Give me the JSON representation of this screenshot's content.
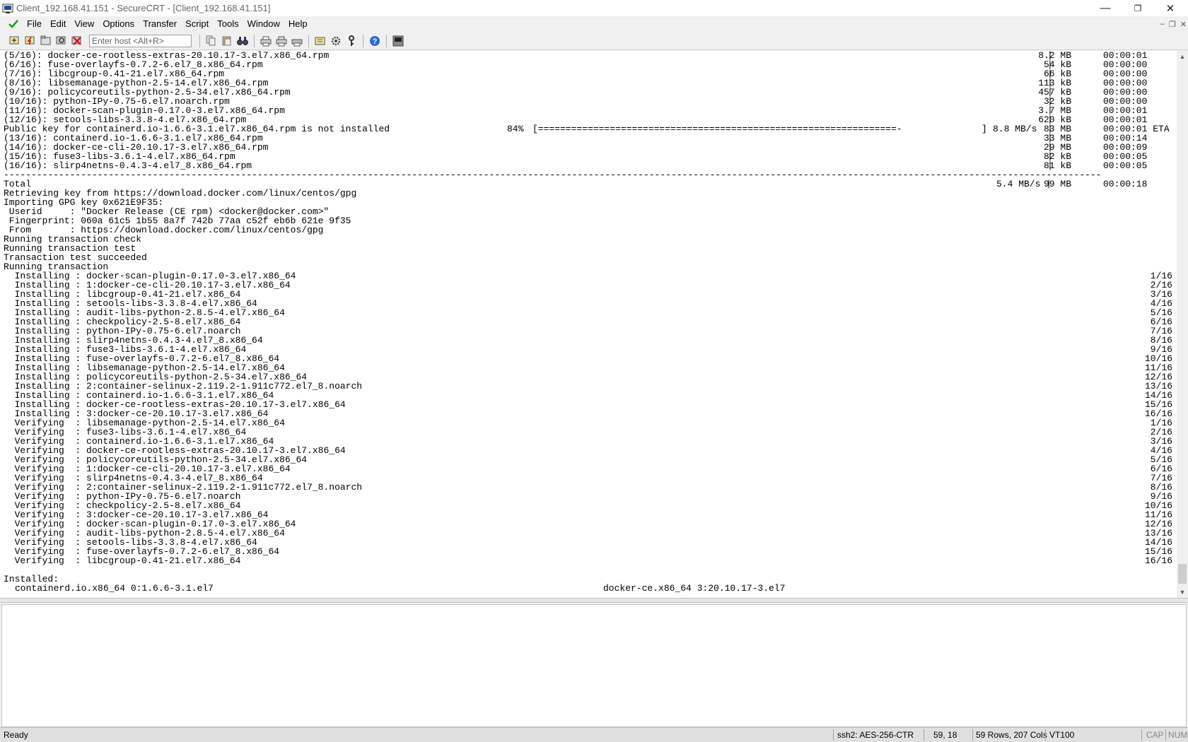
{
  "window": {
    "title": "Client_192.168.41.151 - SecureCRT - [Client_192.168.41.151]"
  },
  "menu": [
    "File",
    "Edit",
    "View",
    "Options",
    "Transfer",
    "Script",
    "Tools",
    "Window",
    "Help"
  ],
  "toolbar": {
    "host_placeholder": "Enter host <Alt+R>"
  },
  "terminal": {
    "download_rows": [
      {
        "left": "(5/16): docker-ce-rootless-extras-20.10.17-3.el7.x86_64.rpm",
        "size": "8.2 MB",
        "time": "00:00:01"
      },
      {
        "left": "(6/16): fuse-overlayfs-0.7.2-6.el7_8.x86_64.rpm",
        "size": "54 kB",
        "time": "00:00:00"
      },
      {
        "left": "(7/16): libcgroup-0.41-21.el7.x86_64.rpm",
        "size": "66 kB",
        "time": "00:00:00"
      },
      {
        "left": "(8/16): libsemanage-python-2.5-14.el7.x86_64.rpm",
        "size": "113 kB",
        "time": "00:00:00"
      },
      {
        "left": "(9/16): policycoreutils-python-2.5-34.el7.x86_64.rpm",
        "size": "457 kB",
        "time": "00:00:00"
      },
      {
        "left": "(10/16): python-IPy-0.75-6.el7.noarch.rpm",
        "size": "32 kB",
        "time": "00:00:00"
      },
      {
        "left": "(11/16): docker-scan-plugin-0.17.0-3.el7.x86_64.rpm",
        "size": "3.7 MB",
        "time": "00:00:01"
      },
      {
        "left": "(12/16): setools-libs-3.3.8-4.el7.x86_64.rpm",
        "size": "620 kB",
        "time": "00:00:01"
      },
      {
        "left": "Public key for containerd.io-1.6.6-3.1.el7.x86_64.rpm is not installed",
        "size": "83 MB",
        "time": "00:00:01 ETA"
      },
      {
        "left": "(13/16): containerd.io-1.6.6-3.1.el7.x86_64.rpm",
        "size": "33 MB",
        "time": "00:00:14"
      },
      {
        "left": "(14/16): docker-ce-cli-20.10.17-3.el7.x86_64.rpm",
        "size": "29 MB",
        "time": "00:00:09"
      },
      {
        "left": "(15/16): fuse3-libs-3.6.1-4.el7.x86_64.rpm",
        "size": "82 kB",
        "time": "00:00:05"
      },
      {
        "left": "(16/16): slirp4netns-0.4.3-4.el7_8.x86_64.rpm",
        "size": "81 kB",
        "time": "00:00:05"
      }
    ],
    "progress": {
      "percent": "84%",
      "bar": "[=================================================================-",
      "bar_end": "]",
      "rate": "8.8 MB/s"
    },
    "separator": "-------------------------------------------------------------------------------------------------------------------------------------------------------------------------------------------------------",
    "total": {
      "label": "Total",
      "rate": "5.4 MB/s |",
      "size": "99 MB",
      "time": "00:00:18"
    },
    "info_lines": [
      "Retrieving key from https://download.docker.com/linux/centos/gpg",
      "Importing GPG key 0x621E9F35:",
      " Userid     : \"Docker Release (CE rpm) <docker@docker.com>\"",
      " Fingerprint: 060a 61c5 1b55 8a7f 742b 77aa c52f eb6b 621e 9f35",
      " From       : https://download.docker.com/linux/centos/gpg",
      "Running transaction check",
      "Running transaction test",
      "Transaction test succeeded",
      "Running transaction"
    ],
    "transaction_rows": [
      {
        "text": "  Installing : docker-scan-plugin-0.17.0-3.el7.x86_64",
        "count": "1/16"
      },
      {
        "text": "  Installing : 1:docker-ce-cli-20.10.17-3.el7.x86_64",
        "count": "2/16"
      },
      {
        "text": "  Installing : libcgroup-0.41-21.el7.x86_64",
        "count": "3/16"
      },
      {
        "text": "  Installing : setools-libs-3.3.8-4.el7.x86_64",
        "count": "4/16"
      },
      {
        "text": "  Installing : audit-libs-python-2.8.5-4.el7.x86_64",
        "count": "5/16"
      },
      {
        "text": "  Installing : checkpolicy-2.5-8.el7.x86_64",
        "count": "6/16"
      },
      {
        "text": "  Installing : python-IPy-0.75-6.el7.noarch",
        "count": "7/16"
      },
      {
        "text": "  Installing : slirp4netns-0.4.3-4.el7_8.x86_64",
        "count": "8/16"
      },
      {
        "text": "  Installing : fuse3-libs-3.6.1-4.el7.x86_64",
        "count": "9/16"
      },
      {
        "text": "  Installing : fuse-overlayfs-0.7.2-6.el7_8.x86_64",
        "count": "10/16"
      },
      {
        "text": "  Installing : libsemanage-python-2.5-14.el7.x86_64",
        "count": "11/16"
      },
      {
        "text": "  Installing : policycoreutils-python-2.5-34.el7.x86_64",
        "count": "12/16"
      },
      {
        "text": "  Installing : 2:container-selinux-2.119.2-1.911c772.el7_8.noarch",
        "count": "13/16"
      },
      {
        "text": "  Installing : containerd.io-1.6.6-3.1.el7.x86_64",
        "count": "14/16"
      },
      {
        "text": "  Installing : docker-ce-rootless-extras-20.10.17-3.el7.x86_64",
        "count": "15/16"
      },
      {
        "text": "  Installing : 3:docker-ce-20.10.17-3.el7.x86_64",
        "count": "16/16"
      },
      {
        "text": "  Verifying  : libsemanage-python-2.5-14.el7.x86_64",
        "count": "1/16"
      },
      {
        "text": "  Verifying  : fuse3-libs-3.6.1-4.el7.x86_64",
        "count": "2/16"
      },
      {
        "text": "  Verifying  : containerd.io-1.6.6-3.1.el7.x86_64",
        "count": "3/16"
      },
      {
        "text": "  Verifying  : docker-ce-rootless-extras-20.10.17-3.el7.x86_64",
        "count": "4/16"
      },
      {
        "text": "  Verifying  : policycoreutils-python-2.5-34.el7.x86_64",
        "count": "5/16"
      },
      {
        "text": "  Verifying  : 1:docker-ce-cli-20.10.17-3.el7.x86_64",
        "count": "6/16"
      },
      {
        "text": "  Verifying  : slirp4netns-0.4.3-4.el7_8.x86_64",
        "count": "7/16"
      },
      {
        "text": "  Verifying  : 2:container-selinux-2.119.2-1.911c772.el7_8.noarch",
        "count": "8/16"
      },
      {
        "text": "  Verifying  : python-IPy-0.75-6.el7.noarch",
        "count": "9/16"
      },
      {
        "text": "  Verifying  : checkpolicy-2.5-8.el7.x86_64",
        "count": "10/16"
      },
      {
        "text": "  Verifying  : 3:docker-ce-20.10.17-3.el7.x86_64",
        "count": "11/16"
      },
      {
        "text": "  Verifying  : docker-scan-plugin-0.17.0-3.el7.x86_64",
        "count": "12/16"
      },
      {
        "text": "  Verifying  : audit-libs-python-2.8.5-4.el7.x86_64",
        "count": "13/16"
      },
      {
        "text": "  Verifying  : setools-libs-3.3.8-4.el7.x86_64",
        "count": "14/16"
      },
      {
        "text": "  Verifying  : fuse-overlayfs-0.7.2-6.el7_8.x86_64",
        "count": "15/16"
      },
      {
        "text": "  Verifying  : libcgroup-0.41-21.el7.x86_64",
        "count": "16/16"
      }
    ],
    "installed_header": "Installed:",
    "installed_items": [
      "containerd.io.x86_64 0:1.6.6-3.1.el7",
      "docker-ce.x86_64 3:20.10.17-3.el7"
    ]
  },
  "status": {
    "ready": "Ready",
    "cipher": "ssh2: AES-256-CTR",
    "cursor": "59, 18",
    "size": "59 Rows, 207 Cols",
    "emulation": "VT100",
    "cap": "CAP",
    "num": "NUM"
  }
}
